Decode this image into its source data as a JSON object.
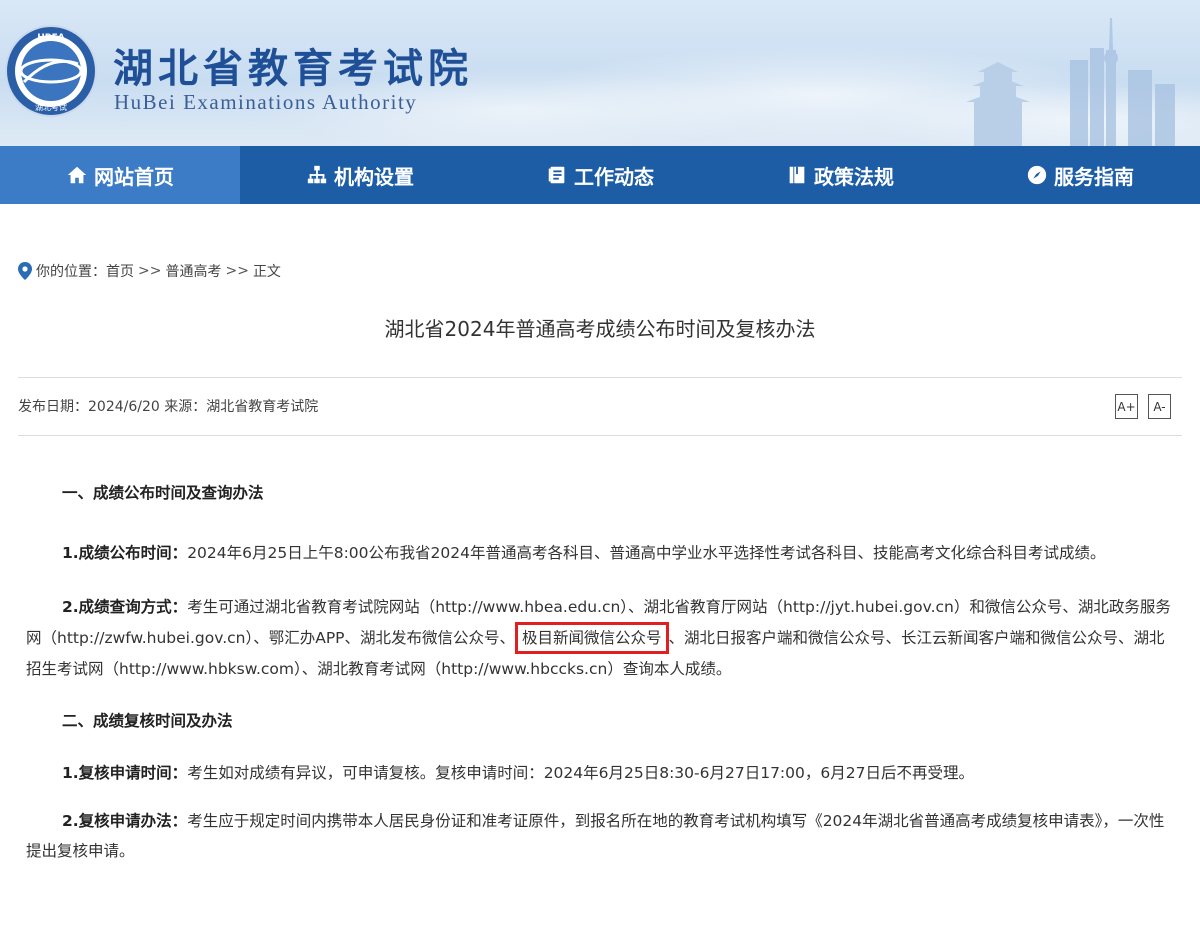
{
  "header": {
    "logo_lettering": "HBEA 湖北考试",
    "title_cn": "湖北省教育考试院",
    "title_en": "HuBei Examinations Authority"
  },
  "nav": [
    {
      "label": "网站首页",
      "icon": "home-icon",
      "active": true
    },
    {
      "label": "机构设置",
      "icon": "org-chart-icon",
      "active": false
    },
    {
      "label": "工作动态",
      "icon": "document-icon",
      "active": false
    },
    {
      "label": "政策法规",
      "icon": "book-icon",
      "active": false
    },
    {
      "label": "服务指南",
      "icon": "compass-icon",
      "active": false
    }
  ],
  "breadcrumb": {
    "prefix": "你的位置：",
    "items": [
      "首页",
      "普通高考",
      "正文"
    ],
    "separator": ">>"
  },
  "article": {
    "title": "湖北省2024年普通高考成绩公布时间及复核办法",
    "meta": "发布日期：2024/6/20 来源：湖北省教育考试院",
    "font_increase": "A+",
    "font_decrease": "A-"
  },
  "content": {
    "section1_heading": "一、成绩公布时间及查询办法",
    "p1_label": "1.成绩公布时间：",
    "p1_text": "2024年6月25日上午8:00公布我省2024年普通高考各科目、普通高中学业水平选择性考试各科目、技能高考文化综合科目考试成绩。",
    "p2_label": "2.成绩查询方式：",
    "p2_text_a": "考生可通过湖北省教育考试院网站（http://www.hbea.edu.cn）、湖北省教育厅网站（http://jyt.hubei.gov.cn）和微信公众号、湖北政务服务网（http://zwfw.hubei.gov.cn）、鄂汇办APP、湖北发布微信公众号、",
    "p2_highlight": "极目新闻微信公众号",
    "p2_text_b": "、湖北日报客户端和微信公众号、长江云新闻客户端和微信公众号、湖北招生考试网（http://www.hbksw.com）、湖北教育考试网（http://www.hbccks.cn）查询本人成绩。",
    "section2_heading": "二、成绩复核时间及办法",
    "p3_label": "1.复核申请时间：",
    "p3_text": "考生如对成绩有异议，可申请复核。复核申请时间：2024年6月25日8:30-6月27日17:00，6月27日后不再受理。",
    "p4_label": "2.复核申请办法：",
    "p4_text": "考生应于规定时间内携带本人居民身份证和准考证原件，到报名所在地的教育考试机构填写《2024年湖北省普通高考成绩复核申请表》，一次性提出复核申请。"
  },
  "colors": {
    "nav_bg": "#1c5da6",
    "nav_active": "#3c7bc6",
    "title_blue": "#1f4f96",
    "highlight_border": "#e02020"
  }
}
